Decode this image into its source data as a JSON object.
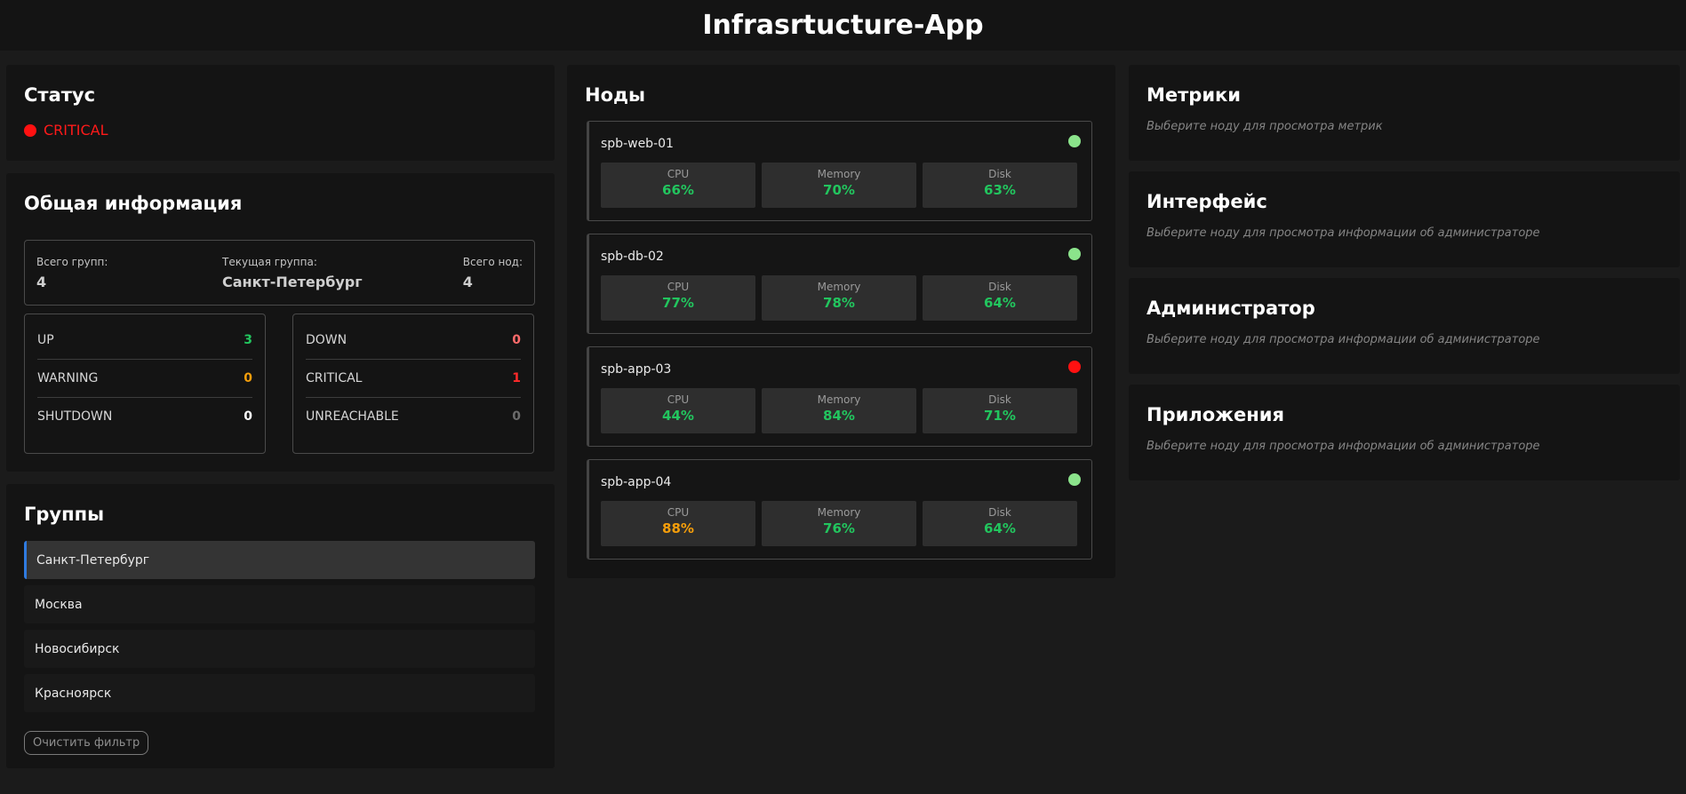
{
  "app": {
    "title": "Infrasrtucture-App"
  },
  "colors": {
    "ok": "#22c55e",
    "warn": "#f59e0b",
    "error": "#ef4444",
    "status_critical": "#ff1a1a",
    "accent": "#2f7be0"
  },
  "status": {
    "title": "Статус",
    "value": "CRITICAL"
  },
  "general": {
    "title": "Общая информация",
    "total_groups_label": "Всего групп:",
    "total_groups_value": "4",
    "current_group_label": "Текущая группа:",
    "current_group_value": "Санкт-Петербург",
    "total_nodes_label": "Всего нод:",
    "total_nodes_value": "4",
    "counts_left": [
      {
        "label": "UP",
        "value": "3",
        "color": "#22c55e"
      },
      {
        "label": "WARNING",
        "value": "0",
        "color": "#f59e0b"
      },
      {
        "label": "SHUTDOWN",
        "value": "0",
        "color": "#ffffff"
      }
    ],
    "counts_right": [
      {
        "label": "DOWN",
        "value": "0",
        "color": "#ff6b6b"
      },
      {
        "label": "CRITICAL",
        "value": "1",
        "color": "#ff2a2a"
      },
      {
        "label": "UNREACHABLE",
        "value": "0",
        "color": "#6b6b6b"
      }
    ]
  },
  "groups": {
    "title": "Группы",
    "items": [
      "Санкт-Петербург",
      "Москва",
      "Новосибирск",
      "Красноярск"
    ],
    "active": "Санкт-Петербург",
    "clear_label": "Очистить фильтр"
  },
  "nodes": {
    "title": "Ноды",
    "items": [
      {
        "name": "spb-web-01",
        "status": "ok",
        "cpu_label": "CPU",
        "cpu": "66%",
        "cpu_state": "ok",
        "mem_label": "Memory",
        "mem": "70%",
        "mem_state": "ok",
        "disk_label": "Disk",
        "disk": "63%",
        "disk_state": "ok"
      },
      {
        "name": "spb-db-02",
        "status": "ok",
        "cpu_label": "CPU",
        "cpu": "77%",
        "cpu_state": "ok",
        "mem_label": "Memory",
        "mem": "78%",
        "mem_state": "ok",
        "disk_label": "Disk",
        "disk": "64%",
        "disk_state": "ok"
      },
      {
        "name": "spb-app-03",
        "status": "critical",
        "cpu_label": "CPU",
        "cpu": "44%",
        "cpu_state": "ok",
        "mem_label": "Memory",
        "mem": "84%",
        "mem_state": "ok",
        "disk_label": "Disk",
        "disk": "71%",
        "disk_state": "ok"
      },
      {
        "name": "spb-app-04",
        "status": "ok",
        "cpu_label": "CPU",
        "cpu": "88%",
        "cpu_state": "warn",
        "mem_label": "Memory",
        "mem": "76%",
        "mem_state": "ok",
        "disk_label": "Disk",
        "disk": "64%",
        "disk_state": "ok"
      }
    ]
  },
  "metrics": {
    "title": "Метрики",
    "hint": "Выберите ноду для просмотра метрик"
  },
  "interface": {
    "title": "Интерфейс",
    "hint": "Выберите ноду для просмотра информации об администраторе"
  },
  "admin": {
    "title": "Администратор",
    "hint": "Выберите ноду для просмотра информации об администраторе"
  },
  "apps": {
    "title": "Приложения",
    "hint": "Выберите ноду для просмотра информации об администраторе"
  }
}
